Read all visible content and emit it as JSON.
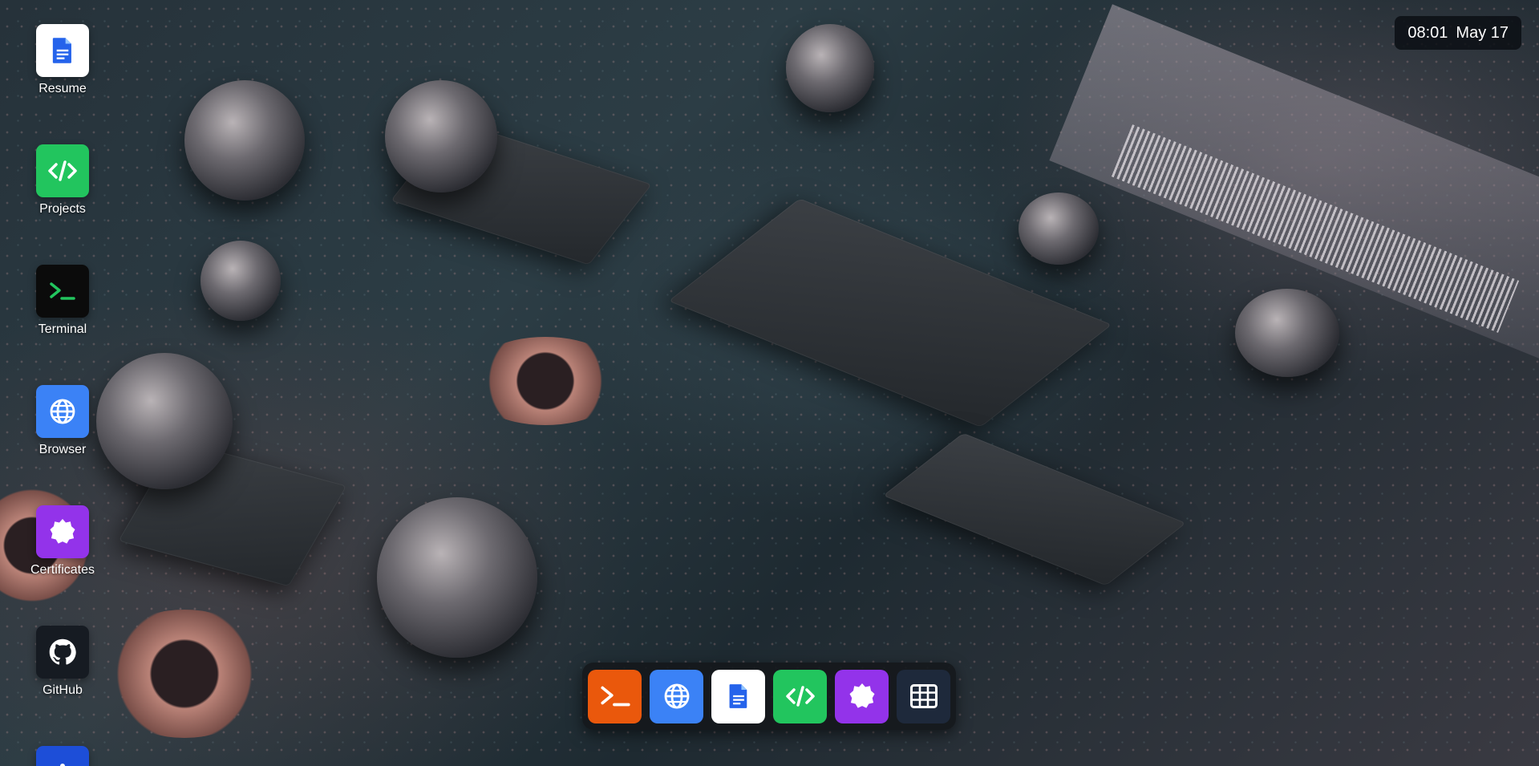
{
  "desktop": {
    "icons": [
      {
        "label": "Resume",
        "icon": "document-icon",
        "color": "#ffffff"
      },
      {
        "label": "Projects",
        "icon": "code-icon",
        "color": "#22c55e"
      },
      {
        "label": "Terminal",
        "icon": "terminal-icon",
        "color": "#0b0b0b"
      },
      {
        "label": "Browser",
        "icon": "globe-icon",
        "color": "#3b82f6"
      },
      {
        "label": "Certificates",
        "icon": "badge-icon",
        "color": "#9333ea"
      },
      {
        "label": "GitHub",
        "icon": "github-icon",
        "color": "#161b22"
      },
      {
        "label": "",
        "icon": "partial-app-icon",
        "color": "#1d4ed8"
      }
    ]
  },
  "clock": {
    "time": "08:01",
    "date": "May 17"
  },
  "dock": {
    "items": [
      {
        "icon": "terminal-icon",
        "color": "#ea580c"
      },
      {
        "icon": "globe-icon",
        "color": "#3b82f6"
      },
      {
        "icon": "document-icon",
        "color": "#ffffff"
      },
      {
        "icon": "code-icon",
        "color": "#22c55e"
      },
      {
        "icon": "badge-icon",
        "color": "#9333ea"
      },
      {
        "icon": "app-grid-icon",
        "color": "#1e293b"
      }
    ]
  }
}
